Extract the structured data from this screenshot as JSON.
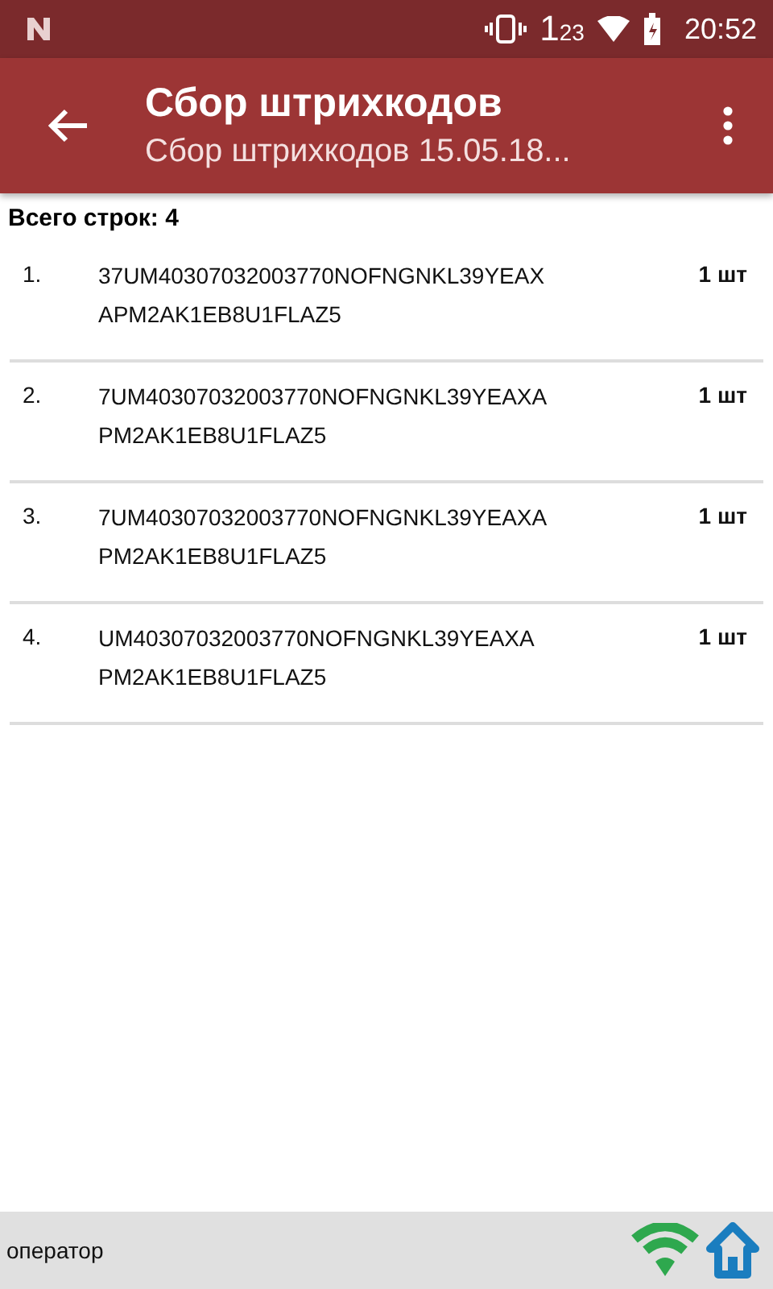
{
  "status_bar": {
    "badge": "1",
    "badge_sub": "23",
    "time": "20:52"
  },
  "app_bar": {
    "title": "Сбор штрихкодов",
    "subtitle": "Сбор штрихкодов 15.05.18..."
  },
  "total": "Всего строк: 4",
  "rows": [
    {
      "number": "1.",
      "code_lines": [
        "37UM40307032003770NOFNGNKL39YEAX",
        "APM2AK1EB8U1FLAZ5"
      ],
      "quantity": "1 шт"
    },
    {
      "number": "2.",
      "code_lines": [
        "7UM40307032003770NOFNGNKL39YEAXA",
        "PM2AK1EB8U1FLAZ5"
      ],
      "quantity": "1 шт"
    },
    {
      "number": "3.",
      "code_lines": [
        "7UM40307032003770NOFNGNKL39YEAXA",
        "PM2AK1EB8U1FLAZ5"
      ],
      "quantity": "1 шт"
    },
    {
      "number": "4.",
      "code_lines": [
        "UM40307032003770NOFNGNKL39YEAXA",
        "PM2AK1EB8U1FLAZ5"
      ],
      "quantity": "1 шт"
    }
  ],
  "footer": {
    "user": "оператор"
  }
}
